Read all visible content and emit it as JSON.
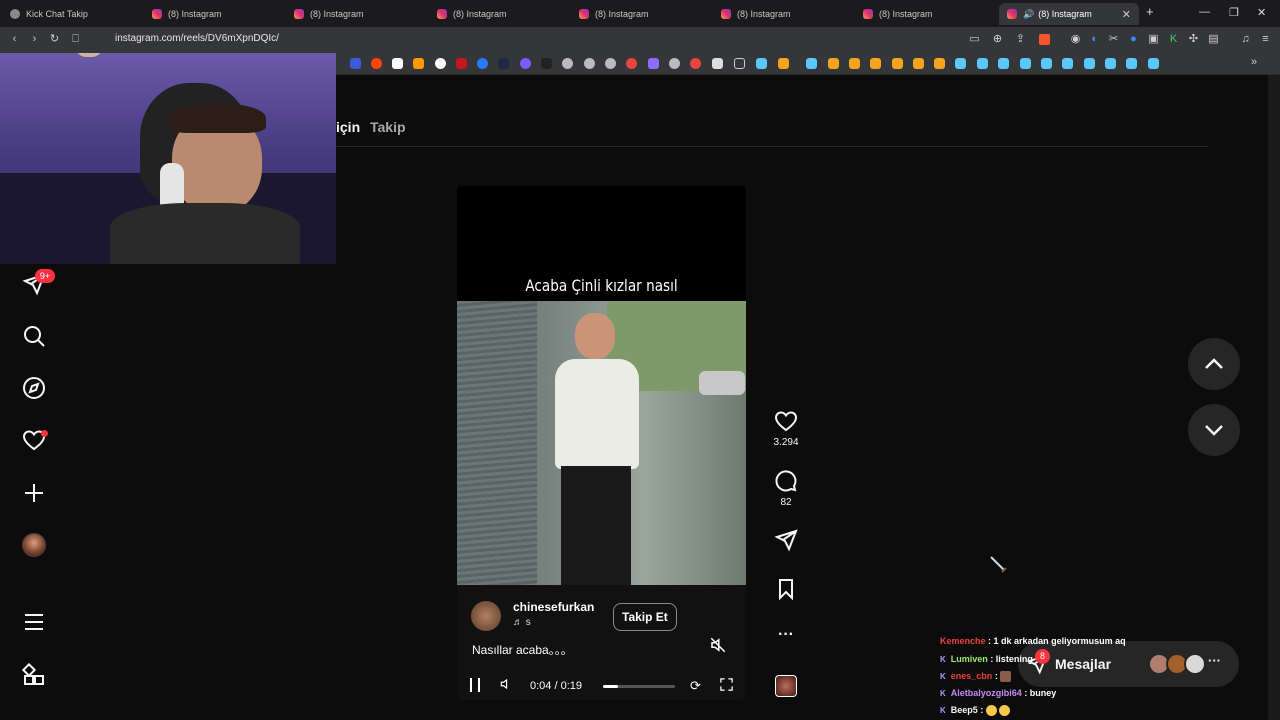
{
  "browser": {
    "tabs": [
      {
        "title": "Kick Chat Takip",
        "favicon": "kick-icon"
      },
      {
        "title": "(8) Instagram",
        "favicon": "instagram-icon"
      },
      {
        "title": "(8) Instagram",
        "favicon": "instagram-icon"
      },
      {
        "title": "(8) Instagram",
        "favicon": "instagram-icon"
      },
      {
        "title": "(8) Instagram",
        "favicon": "instagram-icon"
      },
      {
        "title": "(8) Instagram",
        "favicon": "instagram-icon"
      },
      {
        "title": "(8) Instagram",
        "favicon": "instagram-icon"
      },
      {
        "title": "(8) Instagram",
        "favicon": "instagram-icon",
        "active": true,
        "audio": true
      }
    ],
    "new_tab": "+",
    "close_tab": "✕",
    "url": "instagram.com/reels/DV6mXpnDQIc/"
  },
  "nav_tabs": {
    "for_you": "için",
    "following": "Takip"
  },
  "sidebar": {
    "notification_badge": "9+",
    "icons": [
      "direct-icon",
      "search-icon",
      "explore-icon",
      "heart-icon",
      "create-icon",
      "profile-avatar",
      "menu-icon",
      "more-apps-icon"
    ]
  },
  "reel": {
    "overlay_caption": "Acaba Çinli kızlar nasıl",
    "username": "chinesefurkan",
    "follow_label": "Takip Et",
    "audio_line": "♬ s",
    "description": "Nasıllar acaba。。。",
    "time": "0:04 / 0:19",
    "progress": 0.21
  },
  "actions": {
    "likes": "3.294",
    "comments": "82"
  },
  "messages": {
    "label": "Mesajlar",
    "badge": "8"
  },
  "chat": [
    {
      "user": "Kemenche",
      "text": ": 1 dk arkadan geliyormusum aq",
      "color": "#e8453c"
    },
    {
      "user": "Lumiven",
      "text": ": listening",
      "color": "#9fe870"
    },
    {
      "user": "enes_cbn",
      "text": ":",
      "color": "#e8453c"
    },
    {
      "user": "Aletbalyozgibi64",
      "text": ": buney",
      "color": "#c58af9"
    },
    {
      "user": "Beep5",
      "text": ":",
      "color": "#f5f5f5"
    }
  ],
  "colors": {
    "accent_red": "#ff3040",
    "background": "#0c0c0c",
    "surface": "#262626"
  }
}
